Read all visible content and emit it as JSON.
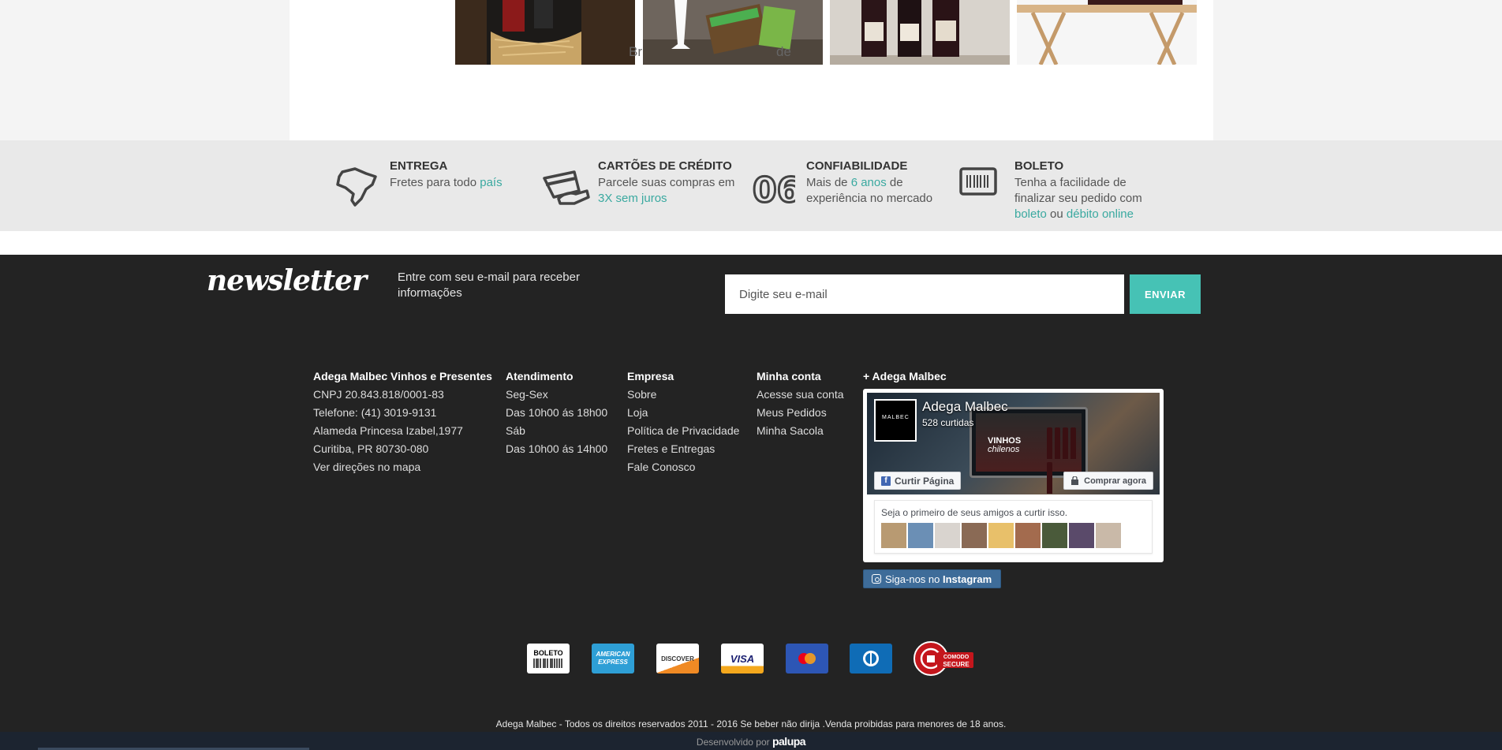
{
  "products": {
    "caption": "Br                                    de"
  },
  "features": [
    {
      "icon": "brazil-map-icon",
      "title": "ENTREGA",
      "line1_prefix": "Fretes para todo ",
      "line1_link": "país"
    },
    {
      "icon": "credit-card-icon",
      "title": "CARTÕES DE CRÉDITO",
      "line1": "Parcele suas compras em",
      "line2_link": "3X sem juros"
    },
    {
      "icon": "years-06-icon",
      "title": "CONFIABILIDADE",
      "line1_prefix": "Mais de ",
      "line1_link": "6 anos",
      "line1_suffix": " de",
      "line2": "experiência no mercado"
    },
    {
      "icon": "barcode-icon",
      "title": "BOLETO",
      "line1": "Tenha a facilidade de",
      "line2": "finalizar seu pedido com",
      "line3_link1": "boleto",
      "line3_mid": " ou ",
      "line3_link2": "débito online"
    }
  ],
  "newsletter": {
    "logo": "newsletter",
    "text": "Entre com seu e-mail para receber informações",
    "placeholder": "Digite seu e-mail",
    "button": "ENVIAR"
  },
  "footer_cols": {
    "company": {
      "title": "Adega Malbec Vinhos e Presentes",
      "lines": [
        "CNPJ 20.843.818/0001-83",
        "Telefone: (41) 3019-9131",
        "Alameda Princesa Izabel,1977",
        "Curitiba, PR 80730-080",
        "Ver direções no mapa"
      ]
    },
    "atendimento": {
      "title": "Atendimento",
      "lines": [
        "Seg-Sex",
        "Das 10h00 ás 18h00",
        "Sáb",
        "Das 10h00 ás 14h00"
      ]
    },
    "empresa": {
      "title": "Empresa",
      "links": [
        "Sobre",
        "Loja",
        "Política de Privacidade",
        "Fretes e Entregas",
        "Fale Conosco"
      ]
    },
    "conta": {
      "title": "Minha conta",
      "links": [
        "Acesse sua conta",
        "Meus Pedidos",
        "Minha Sacola"
      ]
    }
  },
  "facebook": {
    "section_title": "+ Adega Malbec",
    "page_name": "Adega Malbec",
    "likes": "528 curtidas",
    "avatar_text": "MALBEC",
    "cover_text1": "VINHOS",
    "cover_text2": "chilenos",
    "like_button": "Curtir Página",
    "buy_button": "Comprar agora",
    "friends_text": "Seja o primeiro de seus amigos a curtir isso."
  },
  "instagram": {
    "prefix": "Siga-nos no ",
    "label": "Instagram"
  },
  "payments": {
    "boleto": "BOLETO",
    "amex1": "AMERICAN",
    "amex2": "EXPRESS",
    "discover": "DISCOVER",
    "visa": "VISA",
    "comodo1": "COMODO",
    "comodo2": "SECURE"
  },
  "colors": {
    "accent": "#46c2b5",
    "link": "#3aa9a0",
    "footer_bg": "#232323"
  },
  "copyright": "Adega Malbec - Todos os direitos reservados 2011 - 2016 Se beber não dirija .Venda proibidas para menores de 18 anos.",
  "developer": {
    "prefix": "Desenvolvido por ",
    "brand": "palupa"
  }
}
